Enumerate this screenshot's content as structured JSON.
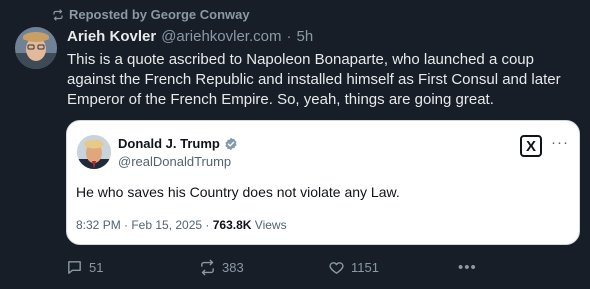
{
  "repost": {
    "label": "Reposted by George Conway",
    "icon": "repost-icon"
  },
  "post": {
    "author_name": "Arieh Kovler",
    "author_handle": "@ariehkovler.com",
    "separator": "·",
    "time": "5h",
    "text": "This is a quote ascribed to Napoleon Bonaparte, who launched a coup against the French Republic and installed himself as First Consul and later Emperor of the French Empire. So, yeah, things are going great."
  },
  "quote": {
    "author_name": "Donald J. Trump",
    "author_handle": "@realDonaldTrump",
    "logo_text": "X",
    "more": "···",
    "text": "He who saves his Country does not violate any Law.",
    "date": "8:32 PM · Feb 15, 2025 ·",
    "views_count": "763.8K",
    "views_label": "Views"
  },
  "actions": {
    "replies": "51",
    "reposts": "383",
    "likes": "1151",
    "more": "•••"
  },
  "colors": {
    "background": "#171e28",
    "secondary_text": "#8b98a5",
    "verified": "#829aab"
  }
}
